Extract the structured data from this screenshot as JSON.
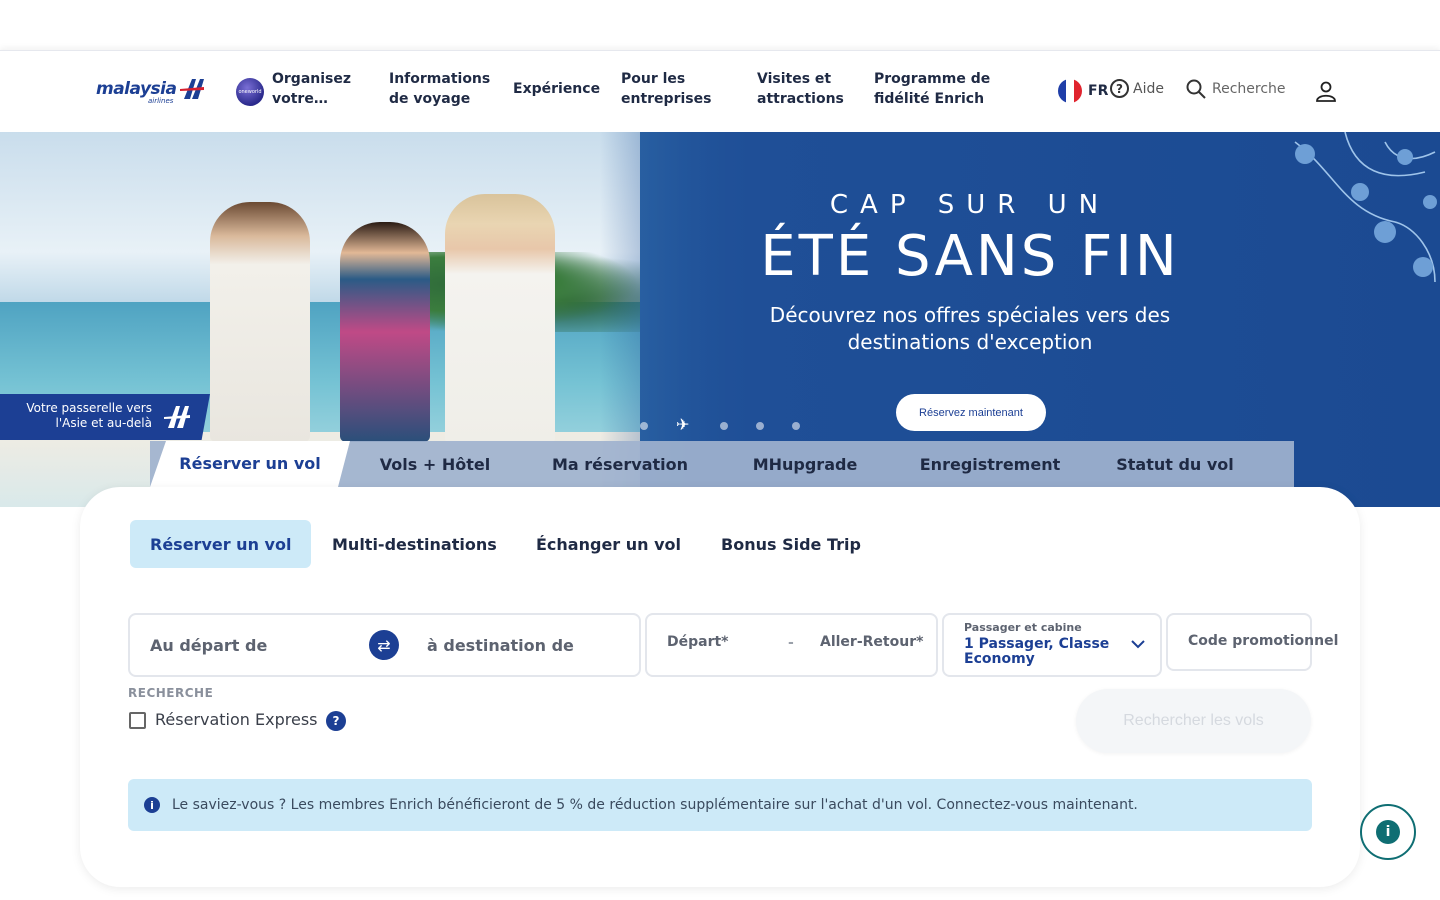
{
  "header": {
    "logo_text": "malaysia",
    "logo_sub": "airlines",
    "oneworld": "oneworld",
    "nav": [
      {
        "label": "Organisez votre…"
      },
      {
        "label": "Informations de voyage"
      },
      {
        "label": "Expérience"
      },
      {
        "label": "Pour les entreprises"
      },
      {
        "label": "Visites et attractions"
      },
      {
        "label": "Programme de fidélité Enrich"
      }
    ],
    "lang": "FR",
    "help": "Aide",
    "search_placeholder": "Recherche"
  },
  "hero": {
    "title_line1": "CAP SUR UN",
    "title_line2": "ÉTÉ SANS FIN",
    "subtitle": "Découvrez nos offres spéciales vers des destinations d'exception",
    "cta": "Réservez maintenant",
    "gateway": "Votre passerelle vers l'Asie et au-delà",
    "slide_count": 5,
    "active_slide": 2
  },
  "main_tabs": [
    {
      "label": "Réserver un vol",
      "active": true
    },
    {
      "label": "Vols + Hôtel"
    },
    {
      "label": "Ma réservation"
    },
    {
      "label": "MHupgrade"
    },
    {
      "label": "Enregistrement"
    },
    {
      "label": "Statut du vol"
    }
  ],
  "sub_tabs": [
    {
      "label": "Réserver un vol",
      "active": true
    },
    {
      "label": "Multi-destinations"
    },
    {
      "label": "Échanger un vol"
    },
    {
      "label": "Bonus Side Trip"
    }
  ],
  "form": {
    "from_placeholder": "Au départ de",
    "to_placeholder": "à destination de",
    "depart_label": "Départ*",
    "date_sep": "-",
    "return_label": "Aller-Retour*",
    "pax_title": "Passager et cabine",
    "pax_value": "1 Passager, Classe Economy",
    "promo_label": "Code promotionnel",
    "recherche_label": "RECHERCHE",
    "express_label": "Réservation Express",
    "search_button": "Rechercher les vols"
  },
  "info_banner": "Le saviez-vous ? Les membres Enrich bénéficieront de 5 % de réduction supplémentaire sur l'achat d'un vol. Connectez-vous maintenant.",
  "colors": {
    "brand": "#1c3f94",
    "light_blue": "#cdeaf8",
    "teal": "#0f6e73"
  }
}
